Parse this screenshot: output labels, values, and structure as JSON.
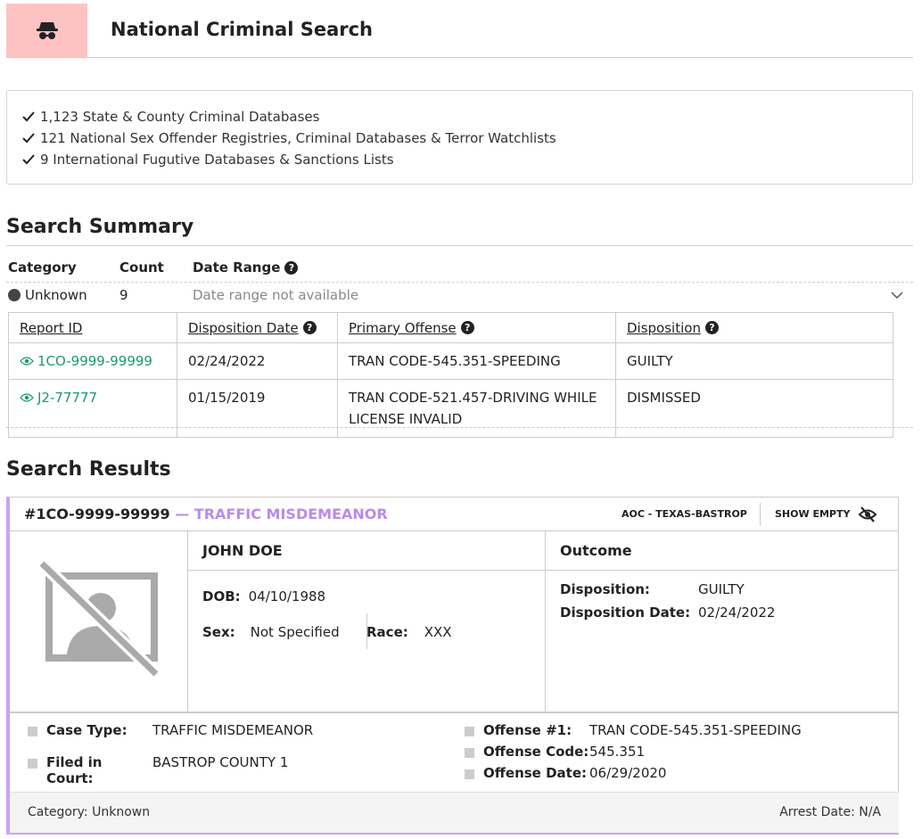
{
  "header": {
    "title": "National Criminal Search",
    "icon": "incognito-icon",
    "icon_bg": "#fdc3c3"
  },
  "databases": [
    "1,123 State & County Criminal Databases",
    "121 National Sex Offender Registries, Criminal Databases & Terror Watchlists",
    "9 International Fugutive Databases & Sanctions Lists"
  ],
  "summary": {
    "title": "Search Summary",
    "headers": {
      "category": "Category",
      "count": "Count",
      "date_range": "Date Range"
    },
    "row": {
      "category": "Unknown",
      "count": "9",
      "date_range": "Date range not available"
    },
    "table": {
      "headers": [
        "Report ID",
        "Disposition Date",
        "Primary Offense",
        "Disposition"
      ],
      "rows": [
        {
          "report_id": "1CO-9999-99999",
          "date": "02/24/2022",
          "offense": "TRAN CODE-545.351-SPEEDING",
          "disposition": "GUILTY"
        },
        {
          "report_id": "J2-77777",
          "date": "01/15/2019",
          "offense": "TRAN CODE-521.457-DRIVING WHILE LICENSE INVALID",
          "disposition": "DISMISSED"
        }
      ]
    }
  },
  "results": {
    "title": "Search Results",
    "card": {
      "id": "#1CO-9999-99999",
      "type": " — TRAFFIC MISDEMEANOR",
      "source": "AOC - TEXAS-BASTROP",
      "show_empty": "SHOW EMPTY",
      "name": "JOHN DOE",
      "dob_label": "DOB:",
      "dob": "04/10/1988",
      "sex_label": "Sex:",
      "sex": "Not Specified",
      "race_label": "Race:",
      "race": "XXX",
      "outcome_title": "Outcome",
      "disposition_label": "Disposition:",
      "disposition": "GUILTY",
      "disposition_date_label": "Disposition Date:",
      "disposition_date": "02/24/2022",
      "case_type_label": "Case Type:",
      "case_type": "TRAFFIC MISDEMEANOR",
      "court_label": "Filed in Court:",
      "court": "BASTROP COUNTY 1",
      "offense_label": "Offense #1:",
      "offense": "TRAN CODE-545.351-SPEEDING",
      "offense_code_label": "Offense Code:",
      "offense_code": "545.351",
      "offense_date_label": "Offense Date:",
      "offense_date": "06/29/2020",
      "category": "Category: Unknown",
      "arrest_date": "Arrest Date: N/A",
      "accent": "#c9a4f0"
    }
  }
}
